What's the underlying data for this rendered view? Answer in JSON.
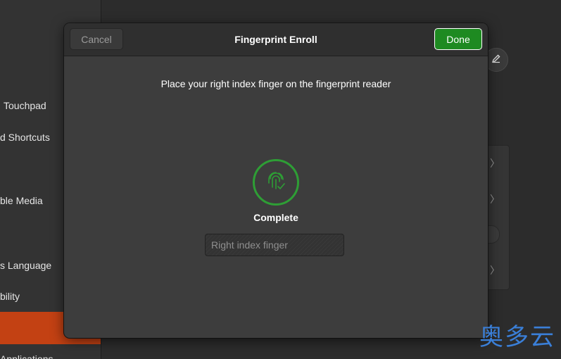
{
  "colors": {
    "accent_green": "#2e9e35",
    "done_green": "#1e8a21",
    "selected_orange": "#c34113",
    "watermark_blue": "#3a7fd8"
  },
  "sidebar": {
    "items": [
      {
        "label": "Touchpad"
      },
      {
        "label": "d Shortcuts"
      },
      {
        "label": "ble Media"
      },
      {
        "label": "s Language"
      },
      {
        "label": "bility"
      },
      {
        "label": ""
      },
      {
        "label": "Applications"
      }
    ]
  },
  "dialog": {
    "title": "Fingerprint Enroll",
    "cancel_label": "Cancel",
    "done_label": "Done",
    "instruction": "Place your right index finger on the fingerprint reader",
    "status": "Complete",
    "finger_name": "Right index finger",
    "icon": "fingerprint-check-icon"
  },
  "watermark": "奥多云"
}
